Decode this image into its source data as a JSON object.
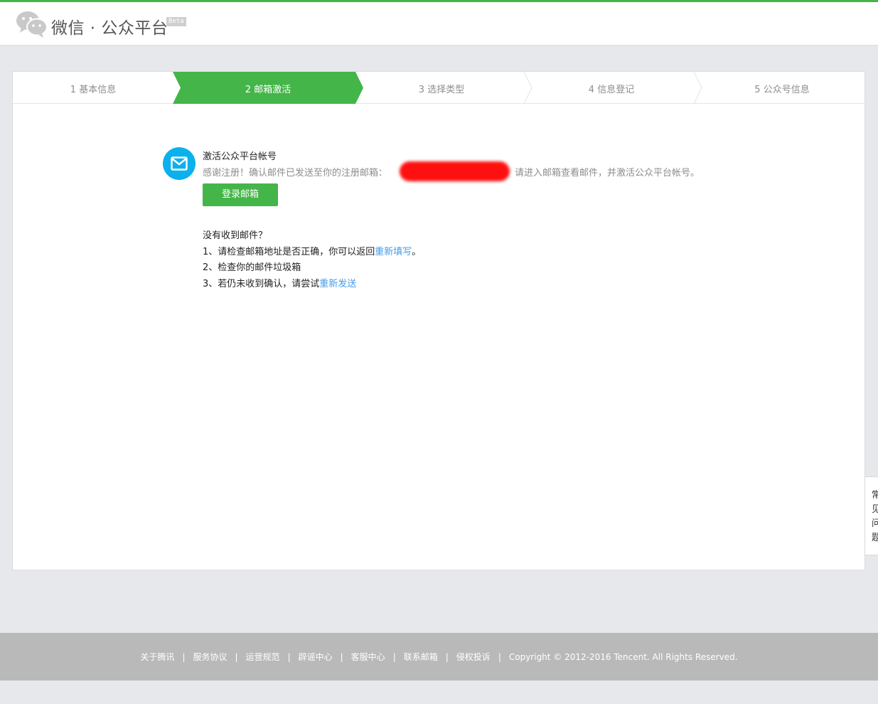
{
  "header": {
    "brand": "微信 · 公众平台",
    "beta": "Beta"
  },
  "steps": [
    {
      "label": "1 基本信息",
      "active": false
    },
    {
      "label": "2 邮箱激活",
      "active": true
    },
    {
      "label": "3 选择类型",
      "active": false
    },
    {
      "label": "4 信息登记",
      "active": false
    },
    {
      "label": "5 公众号信息",
      "active": false
    }
  ],
  "activation": {
    "title": "激活公众平台帐号",
    "desc_before": "感谢注册！确认邮件已发送至你的注册邮箱：",
    "desc_after": "请进入邮箱查看邮件，并激活公众平台帐号。",
    "login_button": "登录邮箱"
  },
  "help": {
    "heading": "没有收到邮件？",
    "line1_text": "1、请检查邮箱地址是否正确，你可以返回",
    "line1_link": "重新填写",
    "line1_end": "。",
    "line2_text": "2、检查你的邮件垃圾箱",
    "line3_text": "3、若仍未收到确认，请尝试",
    "line3_link": "重新发送"
  },
  "side_tab": {
    "label": "常见问题"
  },
  "footer": {
    "links": [
      "关于腾讯",
      "服务协议",
      "运营规范",
      "辟谣中心",
      "客服中心",
      "联系邮箱",
      "侵权投诉"
    ],
    "copyright": "Copyright © 2012-2016 Tencent. All Rights Reserved."
  },
  "colors": {
    "accent": "#44b549",
    "link": "#459ae9",
    "mail_icon": "#0bb1ec"
  },
  "icons": {
    "logo": "wechat-logo-icon",
    "mail": "envelope-icon"
  }
}
